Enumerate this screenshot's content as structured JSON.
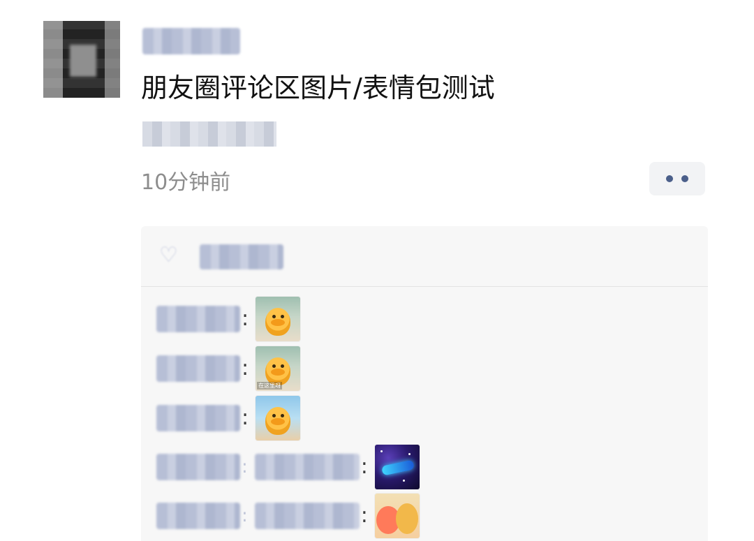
{
  "post": {
    "text": "朋友圈评论区图片/表情包测试",
    "time": "10分钟前"
  },
  "icons": {
    "more": "more-dots-icon",
    "like": "heart-icon"
  },
  "comments": [
    {
      "colon": ":",
      "sticker": "duck-sticker"
    },
    {
      "colon": ":",
      "sticker": "duck-sticker",
      "caption": "在这里呀"
    },
    {
      "colon": ":",
      "sticker": "duck-sticker"
    },
    {
      "colon": ":",
      "sticker": "spaceship-sticker",
      "reply_sep": ":"
    },
    {
      "colon": ":",
      "sticker": "bears-sticker",
      "reply_sep": ":"
    }
  ],
  "colors": {
    "link_blue": "#4b5f8a",
    "panel_bg": "#f7f7f7",
    "time_gray": "#8d8d8d"
  }
}
